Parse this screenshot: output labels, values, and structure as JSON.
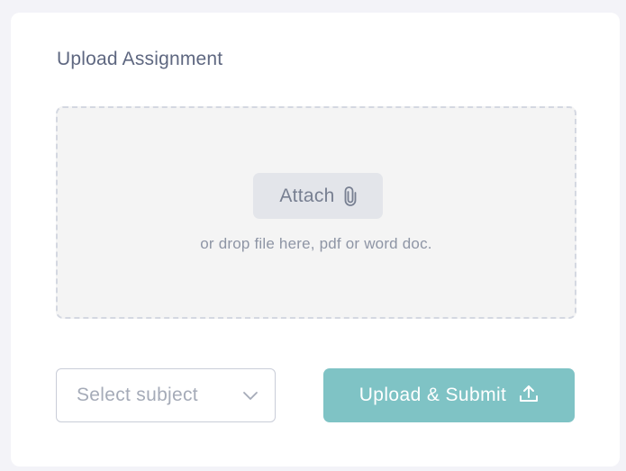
{
  "card": {
    "title": "Upload Assignment"
  },
  "dropzone": {
    "attach_label": "Attach",
    "attach_icon": "paperclip-icon",
    "hint": "or drop file here, pdf or word doc."
  },
  "subject_select": {
    "placeholder": "Select subject",
    "icon": "chevron-down-icon"
  },
  "submit_button": {
    "label": "Upload & Submit",
    "icon": "upload-icon"
  },
  "colors": {
    "accent": "#7fc3c5",
    "title_text": "#5e6780",
    "muted_text": "#8e95a5",
    "dropzone_bg": "#f4f4f4",
    "dropzone_border": "#d4d8e1",
    "attach_bg": "#e3e5ea"
  }
}
